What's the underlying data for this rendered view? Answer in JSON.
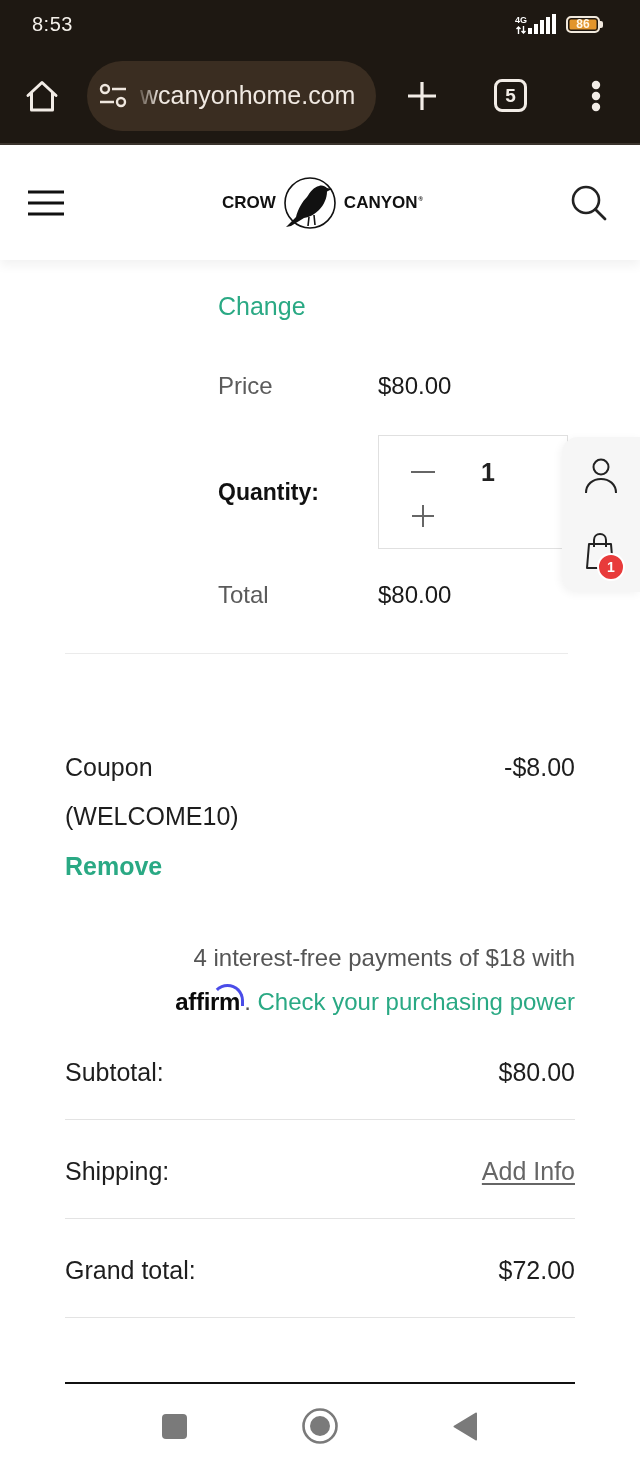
{
  "status_bar": {
    "time": "8:53",
    "network": "4G",
    "battery": "86"
  },
  "browser_toolbar": {
    "url": "wcanyonhome.com",
    "tab_count": "5"
  },
  "site_header": {
    "logo_left": "CROW",
    "logo_right": "CANYON$^{®}$"
  },
  "product": {
    "change_link": "Change",
    "price_label": "Price",
    "price": "$80.00",
    "quantity_label": "Quantity:",
    "quantity": "1",
    "total_label": "Total",
    "total": "$80.00"
  },
  "side_panel": {
    "cart_count": "1"
  },
  "coupon": {
    "label": "Coupon (WELCOME10)",
    "amount": "-$8.00",
    "remove_link": "Remove"
  },
  "affirm": {
    "message": "4 interest-free payments of $18 with",
    "logo": "affirm",
    "separator": ".",
    "link": "Check your purchasing power"
  },
  "summary": [
    {
      "label": "Subtotal:",
      "value": "$80.00",
      "kind": "amount"
    },
    {
      "label": "Shipping:",
      "value": "Add Info",
      "kind": "link"
    },
    {
      "label": "Grand total:",
      "value": "$72.00",
      "kind": "amount"
    }
  ]
}
